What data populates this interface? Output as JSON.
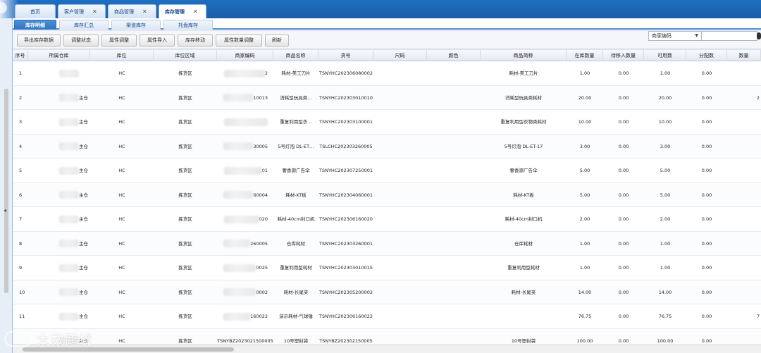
{
  "main_tabs": [
    {
      "label": "首页",
      "closable": false,
      "active": false
    },
    {
      "label": "客户管理",
      "closable": true,
      "active": false
    },
    {
      "label": "商品管理",
      "closable": true,
      "active": false
    },
    {
      "label": "库存管理",
      "closable": true,
      "active": true
    }
  ],
  "sub_tabs": [
    {
      "label": "库存明细",
      "active": true
    },
    {
      "label": "库存汇总",
      "active": false
    },
    {
      "label": "渠道库存",
      "active": false
    },
    {
      "label": "托盘库存",
      "active": false
    }
  ],
  "toolbar": {
    "buttons": [
      "导出库存数据",
      "调整状态",
      "属性调整",
      "属性导入",
      "库存移动",
      "属性数量调整",
      "刷新"
    ],
    "search_field_label": "商家编码",
    "search_value": ""
  },
  "columns": [
    "序号",
    "所属仓库",
    "库位",
    "库位区域",
    "商家编码",
    "商品名称",
    "货号",
    "尺码",
    "颜色",
    "商品简称",
    "在库数量",
    "待移入数量",
    "可用数",
    "分配数",
    "数量"
  ],
  "rows": [
    {
      "no": "1",
      "warehouse": "",
      "loc": "HC",
      "area": "拣货区",
      "code": "2",
      "name": "耗材-美工刀片",
      "sku": "TSNYHC202306080002",
      "size": "",
      "color": "",
      "short": "耗材-美工刀片",
      "qty": "1.00",
      "pending": "0.00",
      "avail": "1.00",
      "alloc": "0.00",
      "num": ""
    },
    {
      "no": "2",
      "warehouse": "主仓",
      "loc": "HC",
      "area": "拣货区",
      "code": "10013",
      "name": "消耗型玩具类…",
      "sku": "TSNYHC202303010010",
      "size": "",
      "color": "",
      "short": "消耗型玩具类耗材",
      "qty": "20.00",
      "pending": "0.00",
      "avail": "20.00",
      "alloc": "0.00",
      "num": "2"
    },
    {
      "no": "3",
      "warehouse": "主仓",
      "loc": "HC",
      "area": "拣货区",
      "code": "",
      "name": "重复利用型衣…",
      "sku": "TSNYHC202303100001",
      "size": "",
      "color": "",
      "short": "重复利用型衣物类耗材",
      "qty": "10.00",
      "pending": "0.00",
      "avail": "10.00",
      "alloc": "0.00",
      "num": ""
    },
    {
      "no": "4",
      "warehouse": "主仓",
      "loc": "HC",
      "area": "拣货区",
      "code": "30005",
      "name": "5号灯泡 DL-ET…",
      "sku": "TSLCHC202303260005",
      "size": "",
      "color": "",
      "short": "5号灯泡 DL-ET-17",
      "qty": "3.00",
      "pending": "0.00",
      "avail": "3.00",
      "alloc": "0.00",
      "num": ""
    },
    {
      "no": "5",
      "warehouse": "主仓",
      "loc": "HC",
      "area": "拣货区",
      "code": "01",
      "name": "奢香源广告伞",
      "sku": "TSNYHC202307250001",
      "size": "",
      "color": "",
      "short": "奢香源广告伞",
      "qty": "5.00",
      "pending": "0.00",
      "avail": "5.00",
      "alloc": "0.00",
      "num": ""
    },
    {
      "no": "6",
      "warehouse": "主仓",
      "loc": "HC",
      "area": "拣货区",
      "code": "60004",
      "name": "耗材-KT板",
      "sku": "TSNYHC202304060001",
      "size": "",
      "color": "",
      "short": "耗材-KT板",
      "qty": "5.00",
      "pending": "0.00",
      "avail": "5.00",
      "alloc": "0.00",
      "num": ""
    },
    {
      "no": "7",
      "warehouse": "主仓",
      "loc": "HC",
      "area": "拣货区",
      "code": "020",
      "name": "耗材-40cm封口机",
      "sku": "TSNYHC202306160020",
      "size": "",
      "color": "",
      "short": "耗材-40cm封口机",
      "qty": "2.00",
      "pending": "0.00",
      "avail": "2.00",
      "alloc": "0.00",
      "num": ""
    },
    {
      "no": "8",
      "warehouse": "主仓",
      "loc": "HC",
      "area": "拣货区",
      "code": "260005",
      "name": "仓库耗材",
      "sku": "TSNYHC202303260001",
      "size": "",
      "color": "",
      "short": "仓库耗材",
      "qty": "1.00",
      "pending": "0.00",
      "avail": "1.00",
      "alloc": "0.00",
      "num": ""
    },
    {
      "no": "9",
      "warehouse": "主仓",
      "loc": "HC",
      "area": "拣货区",
      "code": "0025",
      "name": "重复利用型耗材",
      "sku": "TSNYHC202303010015",
      "size": "",
      "color": "",
      "short": "重复利用型耗材",
      "qty": "1.00",
      "pending": "0.00",
      "avail": "1.00",
      "alloc": "0.00",
      "num": ""
    },
    {
      "no": "10",
      "warehouse": "主仓",
      "loc": "HC",
      "area": "拣货区",
      "code": "0002",
      "name": "耗材-长尾夹",
      "sku": "TSNYHC202305200002",
      "size": "",
      "color": "",
      "short": "耗材-长尾夹",
      "qty": "14.00",
      "pending": "0.00",
      "avail": "14.00",
      "alloc": "0.00",
      "num": ""
    },
    {
      "no": "11",
      "warehouse": "主仓",
      "loc": "HC",
      "area": "拣货区",
      "code": "160022",
      "name": "演示耗材-气球锤",
      "sku": "TSNYHC202306160022",
      "size": "",
      "color": "",
      "short": "",
      "qty": "76.75",
      "pending": "0.00",
      "avail": "76.75",
      "alloc": "0.00",
      "num": "7"
    },
    {
      "no": "",
      "warehouse": "主仓",
      "loc": "HC",
      "area": "拣货区",
      "code": "TSNYBZ2023021500005",
      "name": "10号塑封袋",
      "sku": "TSNYBZ202302150005",
      "size": "",
      "color": "",
      "short": "10号塑封袋",
      "qty": "100.00",
      "pending": "0.00",
      "avail": "100.00",
      "alloc": "0.00",
      "num": ""
    }
  ],
  "watermark": "大数跨境"
}
